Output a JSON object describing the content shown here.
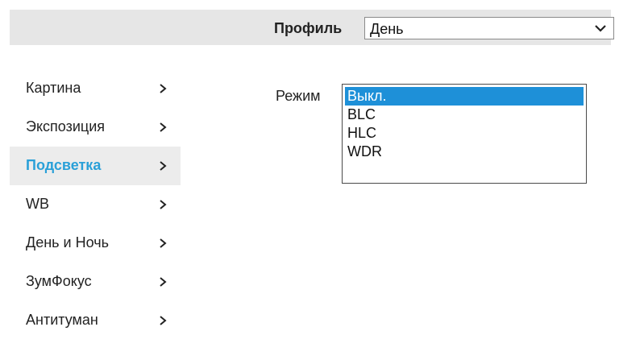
{
  "profile": {
    "label": "Профиль",
    "selected_value": "День"
  },
  "sidebar": {
    "items": [
      {
        "label": "Картина",
        "active": false
      },
      {
        "label": "Экспозиция",
        "active": false
      },
      {
        "label": "Подсветка",
        "active": true
      },
      {
        "label": "WB",
        "active": false
      },
      {
        "label": "День и Ночь",
        "active": false
      },
      {
        "label": "ЗумФокус",
        "active": false
      },
      {
        "label": "Антитуман",
        "active": false
      }
    ],
    "chevron_icon": "chevron-right-icon"
  },
  "mode": {
    "label": "Режим",
    "options": [
      "Выкл.",
      "BLC",
      "HLC",
      "WDR"
    ],
    "selected": "Выкл."
  },
  "colors": {
    "accent": "#2aa0d8",
    "selection": "#1e90d8",
    "bar_background": "#e6e6e6"
  }
}
